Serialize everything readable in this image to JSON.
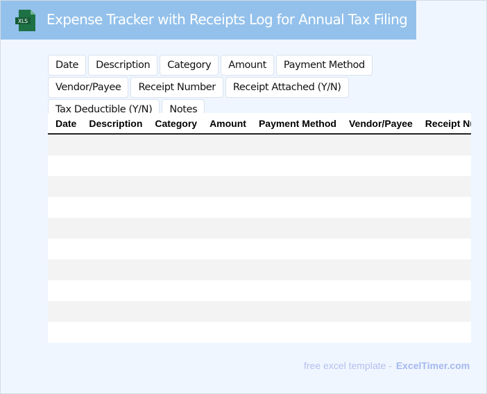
{
  "header": {
    "title": "Expense Tracker with Receipts Log for Annual Tax Filing",
    "icon": "xls-file-icon",
    "icon_label": "XLS",
    "bg_color": "#93c1eb"
  },
  "tags": [
    "Date",
    "Description",
    "Category",
    "Amount",
    "Payment Method",
    "Vendor/Payee",
    "Receipt Number",
    "Receipt Attached (Y/N)",
    "Tax Deductible (Y/N)",
    "Notes"
  ],
  "table": {
    "columns": [
      "Date",
      "Description",
      "Category",
      "Amount",
      "Payment Method",
      "Vendor/Payee",
      "Receipt Number"
    ],
    "row_count": 10
  },
  "footer": {
    "text": "free excel template -",
    "brand": "ExcelTimer.com"
  }
}
